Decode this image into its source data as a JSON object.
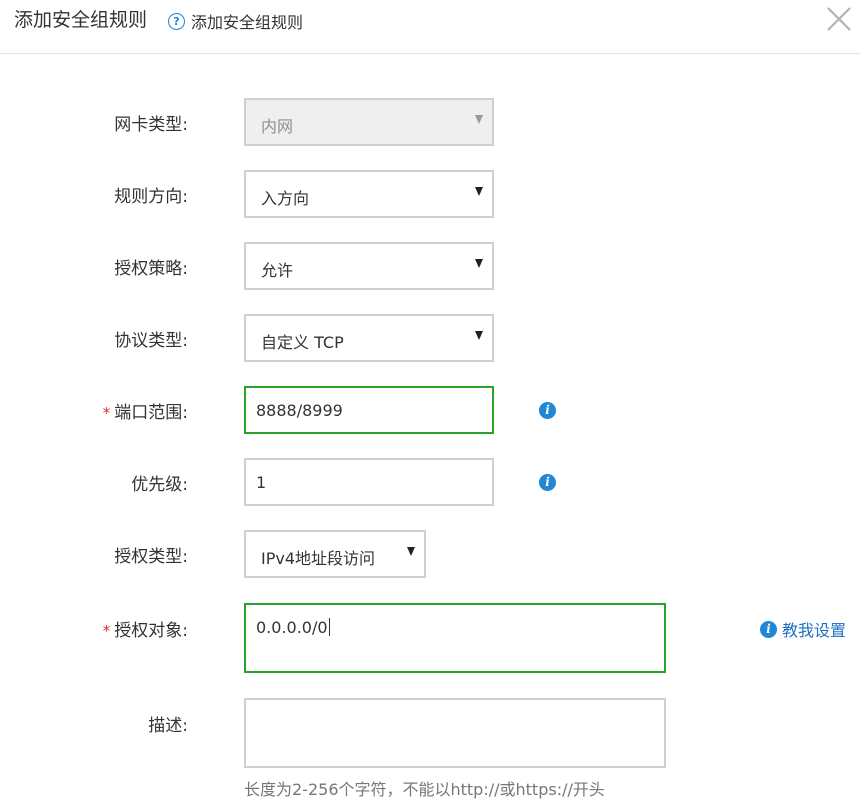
{
  "dialog": {
    "title": "添加安全组规则",
    "help_label": "添加安全组规则"
  },
  "form": {
    "nic_type": {
      "label": "网卡类型:",
      "value": "内网"
    },
    "direction": {
      "label": "规则方向:",
      "value": "入方向"
    },
    "policy": {
      "label": "授权策略:",
      "value": "允许"
    },
    "protocol": {
      "label": "协议类型:",
      "value": "自定义 TCP"
    },
    "port_range": {
      "label": "端口范围:",
      "required_mark": "*",
      "value": "8888/8999"
    },
    "priority": {
      "label": "优先级:",
      "value": "1"
    },
    "auth_type": {
      "label": "授权类型:",
      "value": "IPv4地址段访问"
    },
    "auth_object": {
      "label": "授权对象:",
      "required_mark": "*",
      "value": "0.0.0.0/0",
      "help_link": "教我设置"
    },
    "description": {
      "label": "描述:",
      "value": "",
      "hint": "长度为2-256个字符，不能以http://或https://开头"
    }
  },
  "icons": {
    "help": "question-circle-icon",
    "info": "info-icon",
    "close": "close-icon",
    "dropdown": "caret-down-icon"
  },
  "colors": {
    "accent": "#1f87d6",
    "focus_border": "#2aa22a",
    "required": "#e0322d",
    "link": "#1f6fc4"
  }
}
